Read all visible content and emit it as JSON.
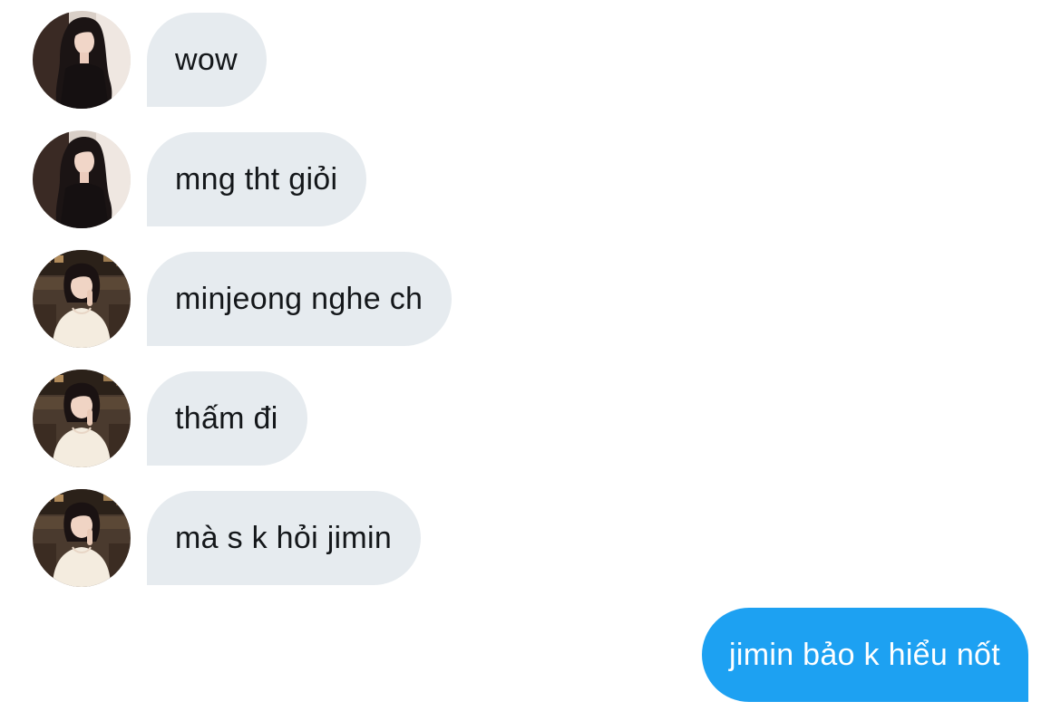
{
  "conversation": {
    "messages": [
      {
        "sender": "contact",
        "avatar": "long-dark-hair-portrait",
        "text": "wow"
      },
      {
        "sender": "contact",
        "avatar": "long-dark-hair-portrait",
        "text": "mng tht giỏi"
      },
      {
        "sender": "contact",
        "avatar": "white-top-portrait",
        "text": "minjeong nghe ch"
      },
      {
        "sender": "contact",
        "avatar": "white-top-portrait",
        "text": "thấm đi"
      },
      {
        "sender": "contact",
        "avatar": "white-top-portrait",
        "text": "mà s k hỏi jimin"
      },
      {
        "sender": "me",
        "text": "jimin bảo k hiểu nốt"
      }
    ]
  },
  "colors": {
    "incoming_bubble": "#e6ebef",
    "outgoing_bubble": "#1da1f2",
    "incoming_text": "#14171a",
    "outgoing_text": "#ffffff"
  }
}
